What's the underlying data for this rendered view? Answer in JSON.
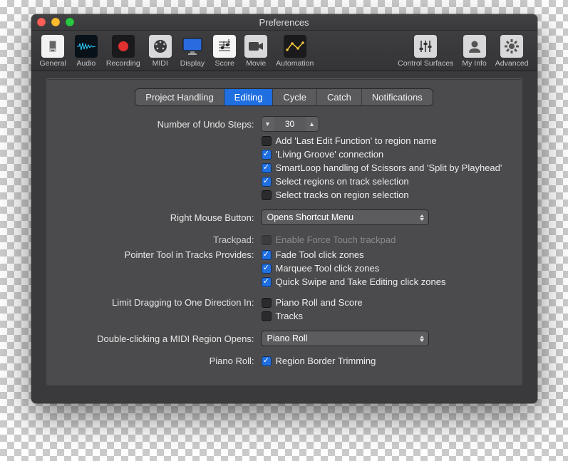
{
  "window": {
    "title": "Preferences"
  },
  "toolbar": {
    "items": [
      {
        "id": "general",
        "label": "General"
      },
      {
        "id": "audio",
        "label": "Audio"
      },
      {
        "id": "recording",
        "label": "Recording"
      },
      {
        "id": "midi",
        "label": "MIDI"
      },
      {
        "id": "display",
        "label": "Display"
      },
      {
        "id": "score",
        "label": "Score"
      },
      {
        "id": "movie",
        "label": "Movie"
      },
      {
        "id": "automation",
        "label": "Automation"
      },
      {
        "id": "control_surfaces",
        "label": "Control Surfaces"
      },
      {
        "id": "my_info",
        "label": "My Info"
      },
      {
        "id": "advanced",
        "label": "Advanced"
      }
    ]
  },
  "tabs": {
    "items": [
      "Project Handling",
      "Editing",
      "Cycle",
      "Catch",
      "Notifications"
    ],
    "active": "Editing"
  },
  "settings": {
    "undo_steps_label": "Number of Undo Steps:",
    "undo_steps_value": "30",
    "add_last_edit": {
      "label": "Add 'Last Edit Function' to region name",
      "checked": false
    },
    "living_groove": {
      "label": "'Living Groove' connection",
      "checked": true
    },
    "smartloop": {
      "label": "SmartLoop handling of Scissors and 'Split by Playhead'",
      "checked": true
    },
    "select_regions": {
      "label": "Select regions on track selection",
      "checked": true
    },
    "select_tracks": {
      "label": "Select tracks on region selection",
      "checked": false
    },
    "right_mouse_label": "Right Mouse Button:",
    "right_mouse_value": "Opens Shortcut Menu",
    "trackpad_label": "Trackpad:",
    "trackpad_option": {
      "label": "Enable Force Touch trackpad",
      "checked": false,
      "disabled": true
    },
    "pointer_tool_label": "Pointer Tool in Tracks Provides:",
    "fade_tool": {
      "label": "Fade Tool click zones",
      "checked": true
    },
    "marquee_tool": {
      "label": "Marquee Tool click zones",
      "checked": true
    },
    "quick_swipe": {
      "label": "Quick Swipe and Take Editing click zones",
      "checked": true
    },
    "limit_drag_label": "Limit Dragging to One Direction In:",
    "piano_roll_score": {
      "label": "Piano Roll and Score",
      "checked": false
    },
    "tracks": {
      "label": "Tracks",
      "checked": false
    },
    "double_click_label": "Double-clicking a MIDI Region Opens:",
    "double_click_value": "Piano Roll",
    "piano_roll_label": "Piano Roll:",
    "region_border": {
      "label": "Region Border Trimming",
      "checked": true
    }
  }
}
